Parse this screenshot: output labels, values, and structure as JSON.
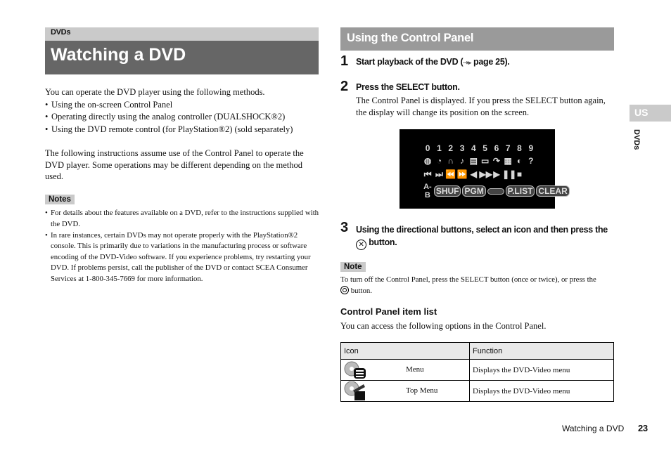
{
  "left": {
    "section_label": "DVDs",
    "title": "Watching a DVD",
    "intro": "You can operate the DVD player using the following methods.",
    "methods": [
      "Using the on-screen Control Panel",
      "Operating directly using the analog controller (DUALSHOCK®2)",
      "Using the DVD remote control (for PlayStation®2) (sold separately)"
    ],
    "instructions": "The following instructions assume use of the Control Panel to operate the DVD player. Some operations may be different depending on the method used.",
    "notes_label": "Notes",
    "notes": [
      "For details about the features available on a DVD, refer to the instructions supplied with the DVD.",
      "In rare instances, certain DVDs may not operate properly with the PlayStation®2 console. This is primarily due to variations in the manufacturing process or software encoding of the DVD-Video software. If you experience problems, try restarting your DVD. If problems persist, call the publisher of the DVD or contact SCEA Consumer Services at 1-800-345-7669 for more information."
    ]
  },
  "right": {
    "title": "Using the Control Panel",
    "steps": [
      {
        "num": "1",
        "text": "Start playback of the DVD (",
        "link": "page 25",
        "tail": ")."
      },
      {
        "num": "2",
        "text": "Press the SELECT button.",
        "desc": "The Control Panel is displayed. If you press the SELECT button again, the display will change its position on the screen."
      },
      {
        "num": "3",
        "text_a": "Using the directional buttons, select an icon and then press the",
        "text_b": "button."
      }
    ],
    "control_panel": {
      "digits": [
        "0",
        "1",
        "2",
        "3",
        "4",
        "5",
        "6",
        "7",
        "8",
        "9"
      ],
      "row2_icons": [
        "menu-icon",
        "top-menu-icon",
        "audio-icon",
        "music-icon",
        "subtitle-icon",
        "title-icon",
        "return-icon",
        "angle-icon",
        "time-icon",
        "help-icon"
      ],
      "row3_icons": [
        "⏮",
        "⏭",
        "⏪",
        "⏩",
        "◀",
        "▶▶",
        "▶",
        "❚❚",
        "■"
      ],
      "row4": [
        "A-B",
        "SHUF",
        "PGM",
        "REPEAT",
        "P.LIST",
        "CLEAR"
      ]
    },
    "note_label": "Note",
    "note_text_a": "To turn off the Control Panel, press the SELECT button (once or twice), or press the",
    "note_text_b": "button.",
    "list_heading": "Control Panel item list",
    "list_intro": "You can access the following options in the Control Panel.",
    "table": {
      "headers": [
        "Icon",
        "Function"
      ],
      "rows": [
        {
          "icon": "menu-icon",
          "label": "Menu",
          "function": "Displays the DVD-Video menu"
        },
        {
          "icon": "top-menu-icon",
          "label": "Top Menu",
          "function": "Displays the DVD-Video menu"
        }
      ]
    }
  },
  "side": {
    "lang": "US",
    "section": "DVDs"
  },
  "footer": {
    "title": "Watching a DVD",
    "page": "23"
  }
}
